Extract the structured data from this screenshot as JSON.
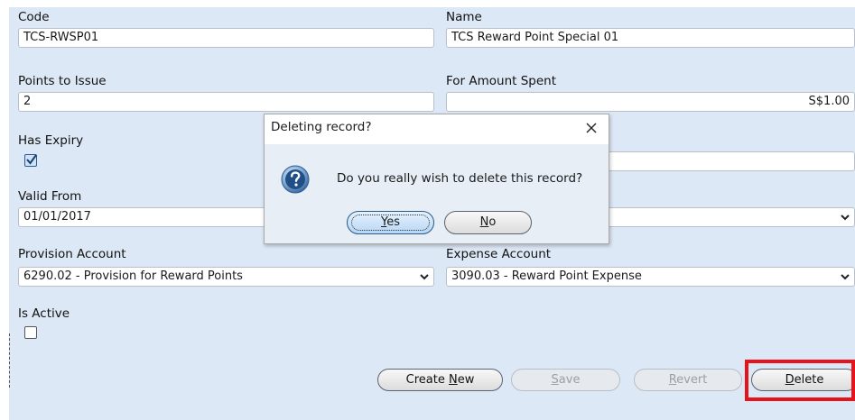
{
  "form": {
    "code": {
      "label": "Code",
      "value": "TCS-RWSP01"
    },
    "name": {
      "label": "Name",
      "value": "TCS Reward Point Special 01"
    },
    "points_to_issue": {
      "label": "Points to Issue",
      "value": "2"
    },
    "for_amount_spent": {
      "label": "For Amount Spent",
      "value": "S$1.00"
    },
    "has_expiry": {
      "label": "Has Expiry",
      "checked": true
    },
    "valid_from": {
      "label": "Valid From",
      "value": "01/01/2017"
    },
    "provision_account": {
      "label": "Provision Account",
      "value": "6290.02 - Provision for Reward Points"
    },
    "expense_account": {
      "label": "Expense Account",
      "value": "3090.03 - Reward Point Expense"
    },
    "is_active": {
      "label": "Is Active",
      "checked": false
    }
  },
  "buttons": {
    "create_new": {
      "pre": "Create ",
      "mnemonic": "N",
      "post": "ew"
    },
    "save": {
      "pre": "",
      "mnemonic": "S",
      "post": "ave"
    },
    "revert": {
      "pre": "",
      "mnemonic": "R",
      "post": "evert"
    },
    "delete": {
      "pre": "",
      "mnemonic": "D",
      "post": "elete"
    }
  },
  "dialog": {
    "title": "Deleting record?",
    "message": "Do you really wish to delete this record?",
    "yes": {
      "mnemonic": "Y",
      "post": "es"
    },
    "no": {
      "mnemonic": "N",
      "post": "o"
    },
    "close_icon": "close-icon",
    "question_icon": "question-icon"
  },
  "colors": {
    "form_background": "#dde8f6",
    "highlight": "#e8121b"
  }
}
